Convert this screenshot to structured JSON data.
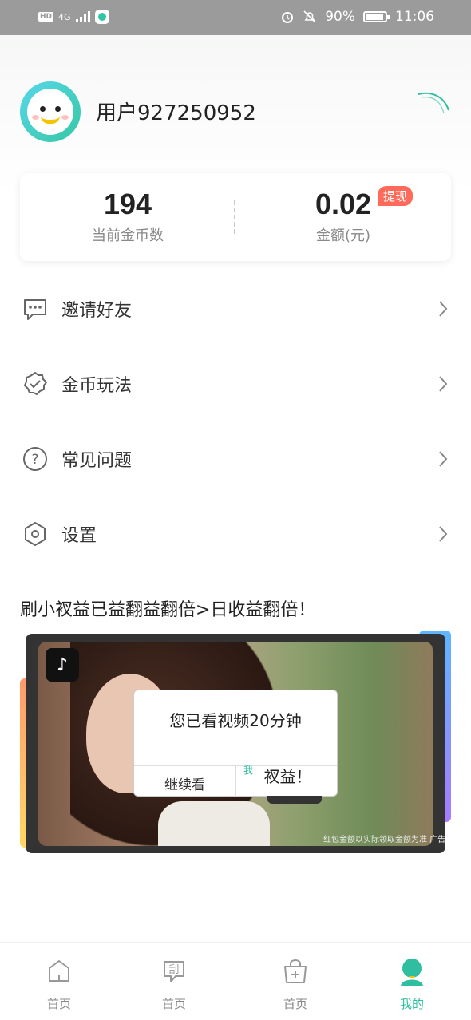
{
  "status_bar": {
    "left_chip": "HD",
    "network": "4G",
    "battery_percent": "90%",
    "time": "11:06"
  },
  "profile": {
    "username": "用户927250952"
  },
  "stats": {
    "coins_value": "194",
    "coins_label": "当前金币数",
    "amount_value": "0.02",
    "amount_label": "金额(元)",
    "withdraw_badge": "提现"
  },
  "menu": {
    "items": [
      {
        "label": "邀请好友",
        "icon": "message-icon"
      },
      {
        "label": "金币玩法",
        "icon": "badge-check-icon"
      },
      {
        "label": "常见问题",
        "icon": "question-icon"
      },
      {
        "label": "设置",
        "icon": "settings-hexagon-icon"
      }
    ]
  },
  "promo": {
    "title": "刷小衩益已益翻益翻倍>日收益翻倍！",
    "dialog_text": "您已看视频20分钟",
    "dialog_left_btn": "继续看",
    "dialog_right_text": "衩益！",
    "dialog_small": "我",
    "ad_caption": "红包金额以实际领取金额为准 广告"
  },
  "bottom_nav": {
    "items": [
      {
        "label": "首页",
        "icon": "home-icon",
        "active": false
      },
      {
        "label": "首页",
        "icon": "scratch-icon",
        "icon_text": "刮",
        "active": false
      },
      {
        "label": "首页",
        "icon": "add-box-icon",
        "active": false
      },
      {
        "label": "我的",
        "icon": "profile-icon",
        "active": true
      }
    ]
  },
  "colors": {
    "accent": "#2fbfa0",
    "badge": "#ff6a5b",
    "status_bar": "#9b9b9b"
  }
}
